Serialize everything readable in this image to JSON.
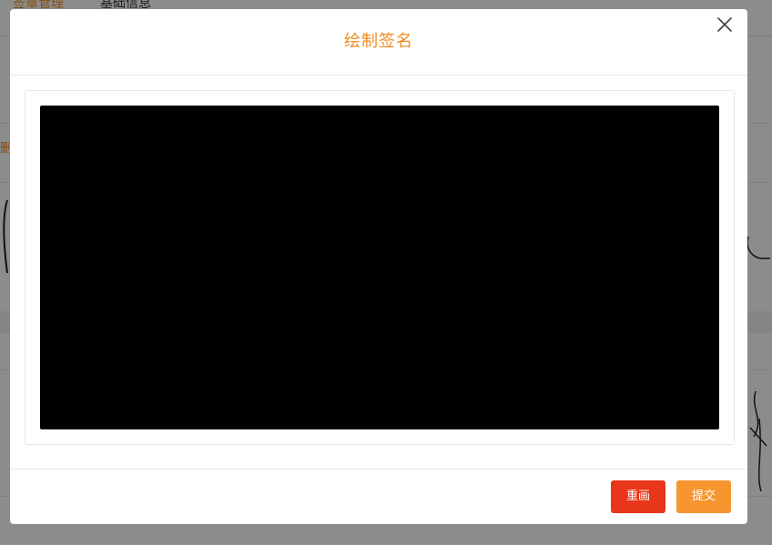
{
  "background": {
    "tabs": [
      {
        "label": "签章管理",
        "active": true
      },
      {
        "label": "基础信息",
        "active": false
      }
    ],
    "side_label": "删"
  },
  "dialog": {
    "title": "绘制签名",
    "close_icon": "close-icon",
    "canvas_color": "#000000",
    "buttons": {
      "redraw_label": "重画",
      "submit_label": "提交"
    }
  },
  "colors": {
    "accent": "#f08c1e",
    "redraw": "#e8361a",
    "submit": "#f7952f"
  }
}
